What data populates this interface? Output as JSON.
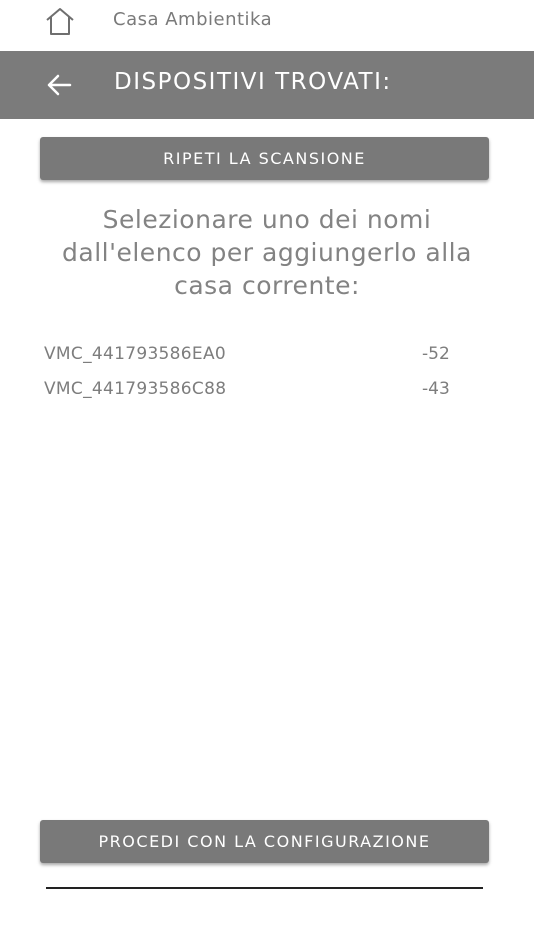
{
  "topbar": {
    "home_label": "Casa Ambientika",
    "home_icon": "home-icon"
  },
  "header": {
    "title": "DISPOSITIVI TROVATI:",
    "back_icon": "arrow-left-icon",
    "background": "#7b7b7b"
  },
  "actions": {
    "rescan_label": "RIPETI LA SCANSIONE",
    "proceed_label": "PROCEDI CON LA CONFIGURAZIONE",
    "button_color": "#797979"
  },
  "instruction": "Selezionare uno dei nomi dall'elenco per aggiungerlo alla casa corrente:",
  "devices": [
    {
      "name": "VMC_441793586EA0",
      "signal": "-52"
    },
    {
      "name": "VMC_441793586C88",
      "signal": "-43"
    }
  ]
}
